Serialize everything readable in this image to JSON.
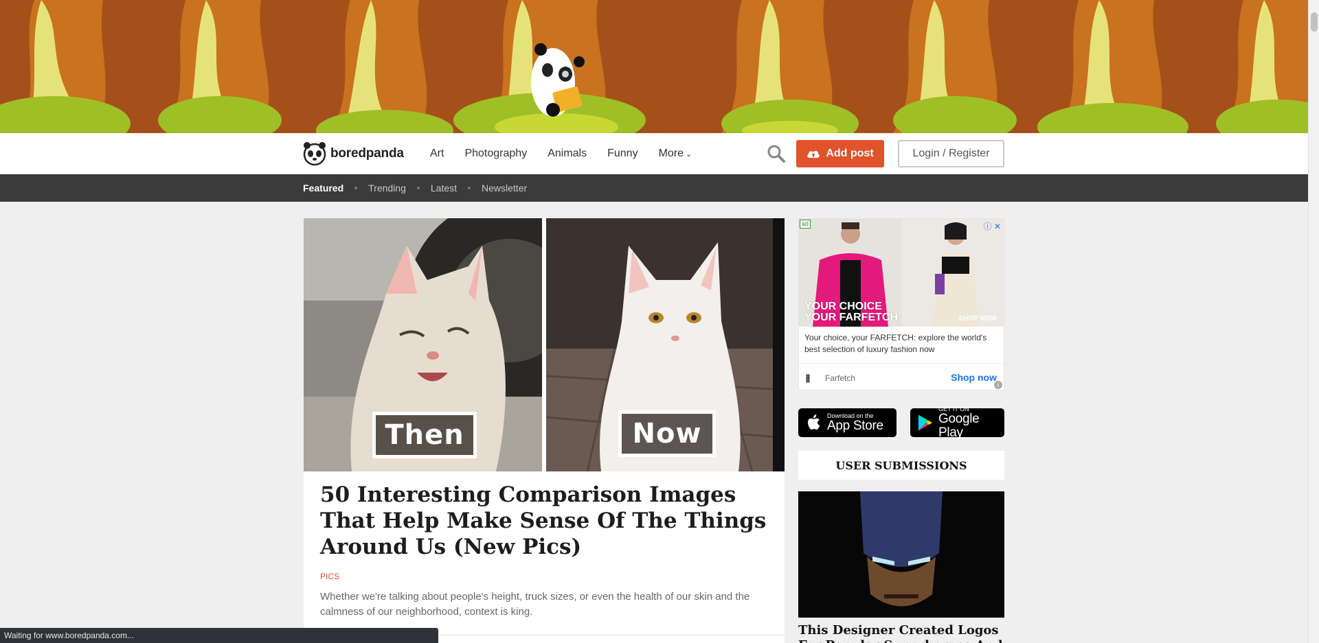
{
  "colors": {
    "accent": "#e0532d",
    "subnav_bg": "#3b3b3b",
    "link_blue": "#1a73e8"
  },
  "brand": {
    "name": "boredpanda"
  },
  "nav": {
    "menu": [
      {
        "label": "Art"
      },
      {
        "label": "Photography"
      },
      {
        "label": "Animals"
      },
      {
        "label": "Funny"
      },
      {
        "label": "More"
      }
    ],
    "add_post_label": "Add post",
    "login_label": "Login / Register"
  },
  "subnav": {
    "items": [
      {
        "label": "Featured",
        "active": true
      },
      {
        "label": "Trending"
      },
      {
        "label": "Latest"
      },
      {
        "label": "Newsletter"
      }
    ]
  },
  "article": {
    "image_labels": {
      "left": "Then",
      "right": "Now"
    },
    "title": "50 Interesting Comparison Images That Help Make Sense Of The Things Around Us (New Pics)",
    "tag": "PICS",
    "description": "Whether we're talking about people's height, truck sizes, or even the health of our skin and the calmness of our neighborhood, context is king."
  },
  "ad": {
    "badge": "ad",
    "headline_line1": "YOUR CHOICE",
    "headline_line2": "YOUR FARFETCH",
    "shop_overlay": "SHOP NOW",
    "text": "Your choice, your FARFETCH: explore the world's best selection of luxury fashion now",
    "advertiser": "Farfetch",
    "cta": "Shop now"
  },
  "stores": {
    "apple_small": "Download on the",
    "apple_big": "App Store",
    "google_small": "GET IT ON",
    "google_big": "Google Play"
  },
  "sidebar": {
    "section_title": "USER SUBMISSIONS",
    "first_item_title": "This Designer Created Logos For Popular Superheroes And"
  },
  "statusbar": {
    "text": "Waiting for www.boredpanda.com..."
  }
}
